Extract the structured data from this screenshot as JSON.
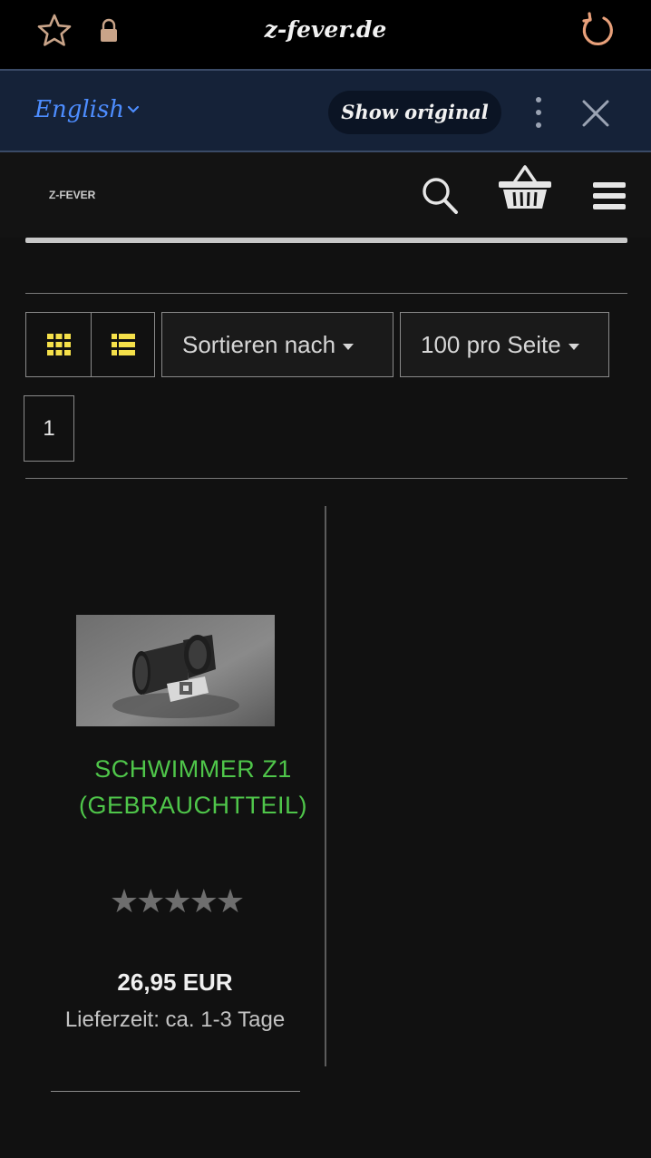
{
  "browser": {
    "domain": "z-fever.de"
  },
  "translate_bar": {
    "language": "English",
    "show_original_label": "Show original"
  },
  "site": {
    "logo_text": "Z-FEVER"
  },
  "toolbar": {
    "sort_label": "Sortieren nach",
    "per_page_label": "100 pro Seite"
  },
  "pagination": {
    "current_page": "1"
  },
  "product": {
    "title": "SCHWIMMER Z1 (GEBRAUCHTTEIL)",
    "rating": 0,
    "rating_max": 5,
    "stars_text": "★★★★★",
    "price": "26,95 EUR",
    "delivery": "Lieferzeit: ca. 1-3 Tage"
  },
  "colors": {
    "title_green": "#4fc64a",
    "icon_yellow": "#f5e04a",
    "translate_blue": "#4d8dff"
  }
}
